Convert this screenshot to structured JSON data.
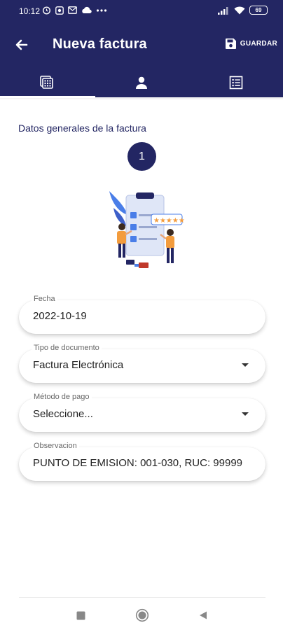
{
  "status_bar": {
    "time": "10:12",
    "battery": "69",
    "icons": [
      "alarm-icon",
      "record-icon",
      "mail-icon",
      "cloud-icon",
      "more-icon",
      "signal-icon",
      "wifi-icon",
      "battery-icon"
    ]
  },
  "appbar": {
    "title": "Nueva factura",
    "save_label": "GUARDAR",
    "back_icon": "arrow-left-icon",
    "save_icon": "floppy-disk-icon"
  },
  "tabs": [
    {
      "icon": "calculator-icon",
      "active": true
    },
    {
      "icon": "person-icon",
      "active": false
    },
    {
      "icon": "list-icon",
      "active": false
    }
  ],
  "section": {
    "title": "Datos generales de la factura",
    "step": "1"
  },
  "form": {
    "fecha": {
      "label": "Fecha",
      "value": "2022-10-19"
    },
    "tipo_documento": {
      "label": "Tipo de documento",
      "value": "Factura Electrónica"
    },
    "metodo_pago": {
      "label": "Método de pago",
      "value": "Seleccione..."
    },
    "observacion": {
      "label": "Observacion",
      "value": "PUNTO DE EMISION: 001-030, RUC: 99999"
    }
  },
  "navbar": {
    "icons": [
      "recents-icon",
      "home-icon",
      "back-icon"
    ]
  },
  "colors": {
    "primary": "#232663",
    "accent_orange": "#f39c3d",
    "accent_blue": "#4a7ee8"
  }
}
